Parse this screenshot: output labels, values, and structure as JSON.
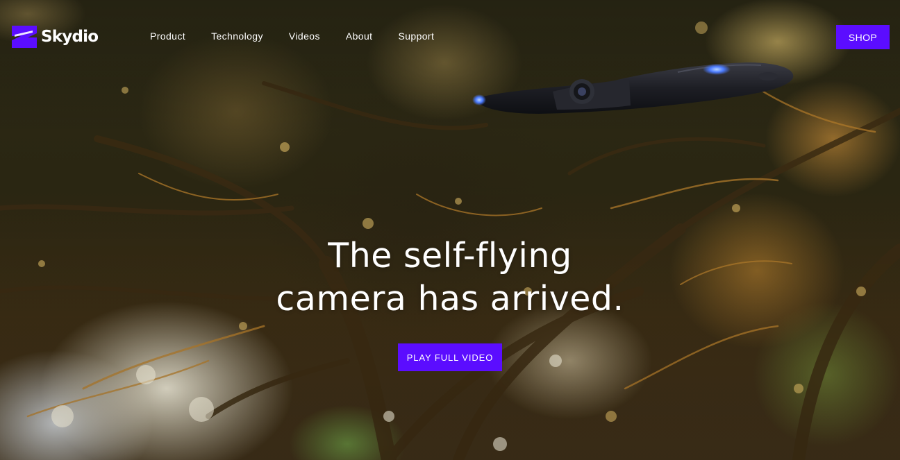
{
  "brand": {
    "name": "Skydio",
    "accent_color": "#5b0dff"
  },
  "nav": {
    "items": [
      {
        "label": "Product"
      },
      {
        "label": "Technology"
      },
      {
        "label": "Videos"
      },
      {
        "label": "About"
      },
      {
        "label": "Support"
      }
    ],
    "shop_label": "SHOP"
  },
  "hero": {
    "headline_line1": "The self-flying",
    "headline_line2": "camera has arrived.",
    "cta_label": "PLAY FULL VIDEO",
    "background": "forest-canopy-sunlight-photo",
    "subject": "drone-in-flight"
  }
}
